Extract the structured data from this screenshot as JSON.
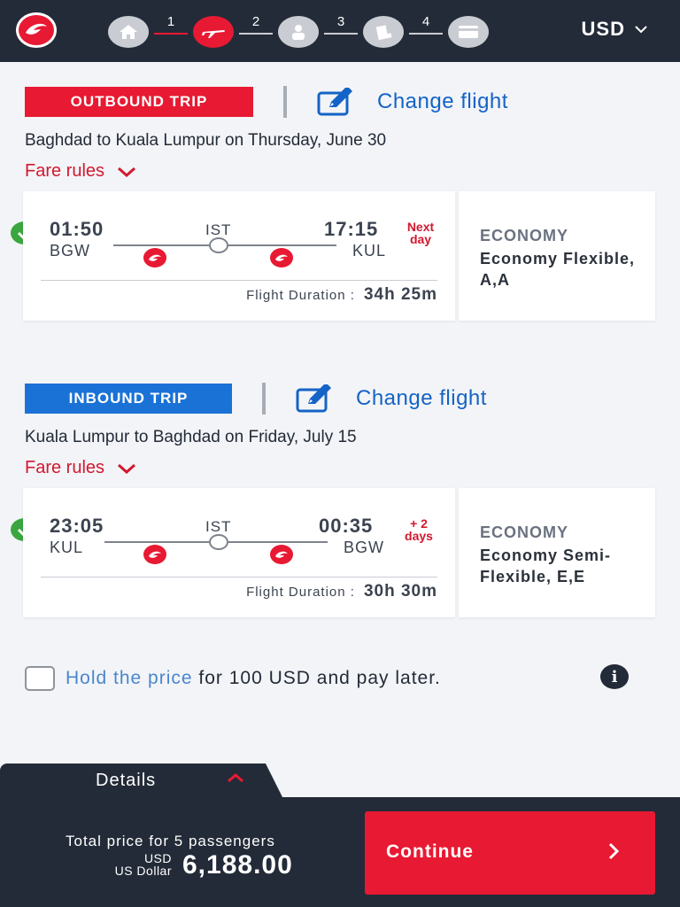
{
  "header": {
    "steps": [
      {
        "number": "",
        "icon": "home-icon",
        "active": false
      },
      {
        "number": "1",
        "icon": "airplane-icon",
        "active": true
      },
      {
        "number": "2",
        "icon": "passenger-icon",
        "active": false
      },
      {
        "number": "3",
        "icon": "seat-icon",
        "active": false
      },
      {
        "number": "4",
        "icon": "payment-card-icon",
        "active": false
      }
    ],
    "currency": "USD"
  },
  "outbound": {
    "badge": "OUTBOUND TRIP",
    "change_link": "Change flight",
    "route": "Baghdad to Kuala Lumpur on Thursday, June 30",
    "fare_rules": "Fare rules",
    "depart_time": "01:50",
    "depart_code": "BGW",
    "hub": "IST",
    "arrive_time": "17:15",
    "arrive_code": "KUL",
    "arrive_note": "Next day",
    "duration_label": "Flight Duration :",
    "duration": "34h 25m",
    "cabin_title": "ECONOMY",
    "cabin_fare": "Economy Flexible, A,A"
  },
  "inbound": {
    "badge": "INBOUND TRIP",
    "change_link": "Change flight",
    "route": "Kuala Lumpur to Baghdad on Friday, July 15",
    "fare_rules": "Fare rules",
    "depart_time": "23:05",
    "depart_code": "KUL",
    "hub": "IST",
    "arrive_time": "00:35",
    "arrive_code": "BGW",
    "arrive_note": "+ 2 days",
    "duration_label": "Flight Duration :",
    "duration": "30h 30m",
    "cabin_title": "ECONOMY",
    "cabin_fare": "Economy Semi-Flexible, E,E"
  },
  "hold": {
    "link": "Hold the price",
    "text": " for 100 USD and pay later."
  },
  "footer": {
    "details_label": "Details",
    "total_label": "Total price for 5 passengers",
    "currency_code": "USD",
    "currency_name": "US Dollar",
    "amount": "6,188.00",
    "continue_label": "Continue"
  },
  "colors": {
    "brand_red": "#e81932",
    "inbound_blue": "#1b72d6",
    "link_blue": "#1463c6",
    "dark_navy": "#232b38",
    "check_green": "#3aa63f"
  }
}
